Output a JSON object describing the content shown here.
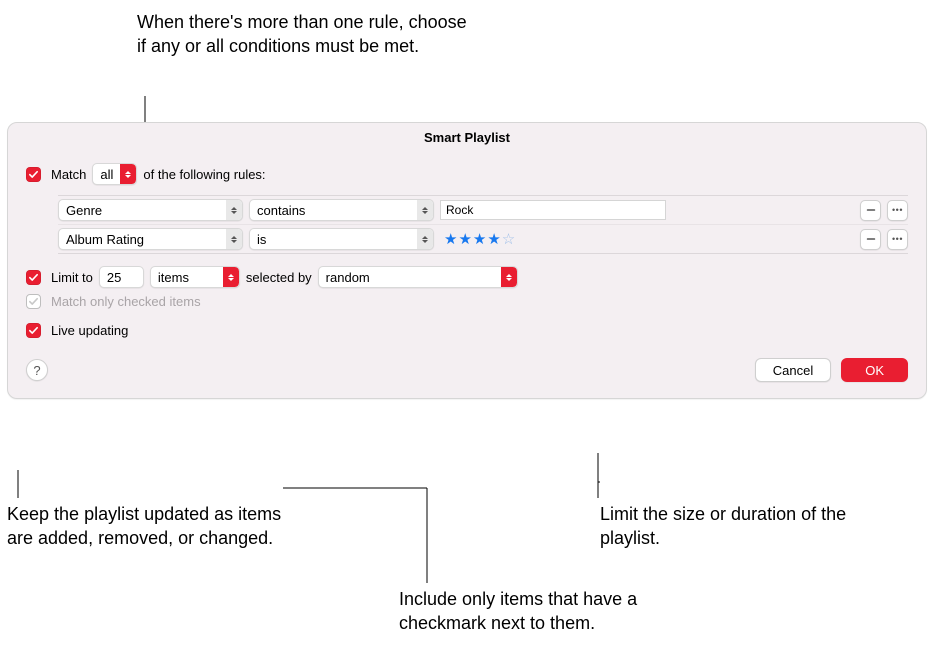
{
  "callouts": {
    "top": "When there's more than one rule, choose if any or all conditions must be met.",
    "live": "Keep the playlist updated as items are added, removed, or changed.",
    "checked": "Include only items that have a checkmark next to them.",
    "limit": "Limit the size or duration of the playlist."
  },
  "dialog": {
    "title": "Smart Playlist",
    "match": {
      "prefix": "Match",
      "mode": "all",
      "suffix": "of the following rules:"
    },
    "rules": [
      {
        "field": "Genre",
        "op": "contains",
        "value": "Rock",
        "valueType": "text"
      },
      {
        "field": "Album Rating",
        "op": "is",
        "value": 4,
        "valueType": "stars"
      }
    ],
    "limit": {
      "prefix": "Limit to",
      "count": "25",
      "unit": "items",
      "mid": "selected by",
      "method": "random"
    },
    "matchOnlyChecked": {
      "label": "Match only checked items",
      "enabled": false
    },
    "liveUpdating": {
      "label": "Live updating"
    },
    "buttons": {
      "cancel": "Cancel",
      "ok": "OK"
    },
    "help": "?"
  }
}
